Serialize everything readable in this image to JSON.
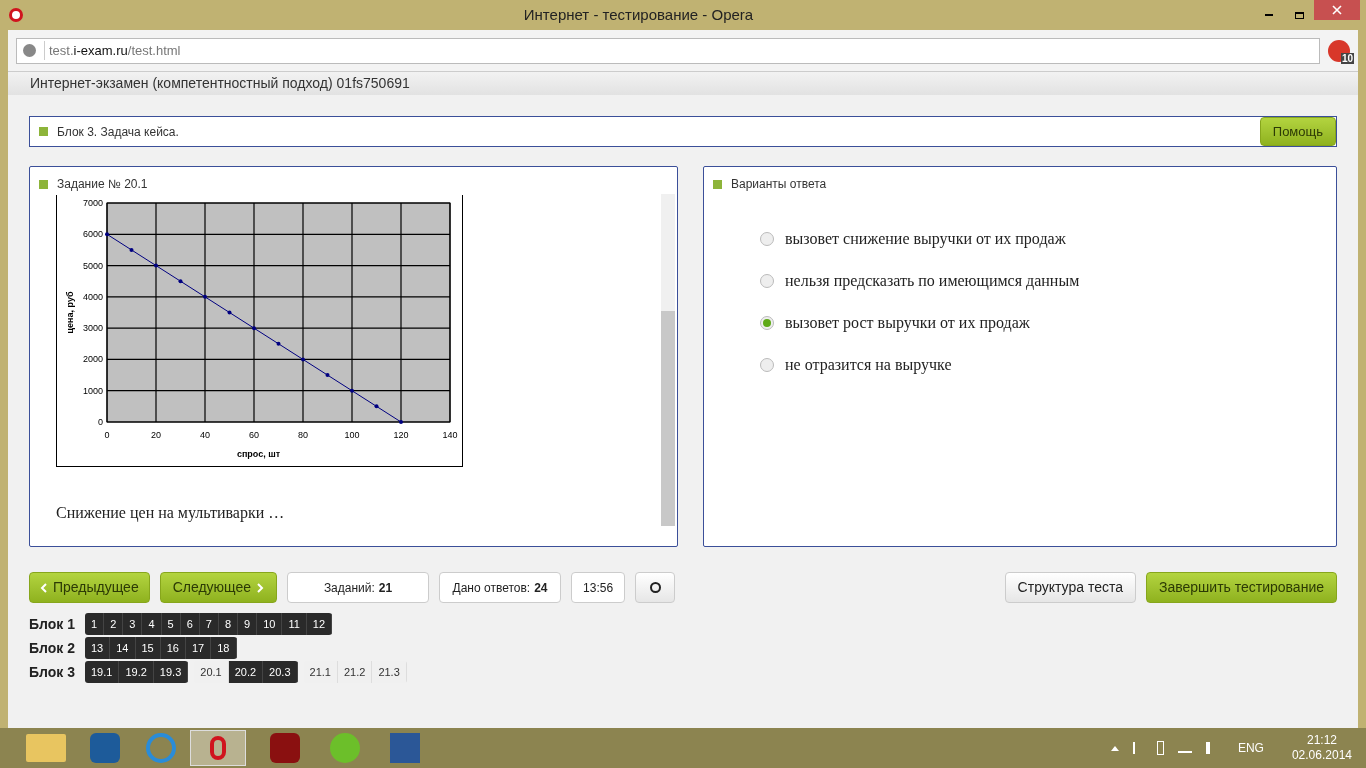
{
  "window": {
    "title": "Интернет - тестирование - Opera"
  },
  "address_bar": {
    "url_prefix": "test.",
    "url_domain": "i-exam.ru",
    "url_path": "/test.html",
    "badge": "10"
  },
  "page_header": "Интернет-экзамен (компетентностный подход) 01fs750691",
  "block_panel": {
    "title": "Блок 3. Задача кейса.",
    "help_button": "Помощь"
  },
  "task_panel": {
    "title": "Задание № 20.1",
    "question": "Снижение цен на мультиварки …",
    "chart_data": {
      "type": "line",
      "grid": true,
      "xlabel": "спрос, шт",
      "ylabel": "цена, руб",
      "xlim": [
        0,
        140
      ],
      "ylim": [
        0,
        7000
      ],
      "xticks": [
        0,
        20,
        40,
        60,
        80,
        100,
        120,
        140
      ],
      "yticks": [
        0,
        1000,
        2000,
        3000,
        4000,
        5000,
        6000,
        7000
      ],
      "series": [
        {
          "color": "#000080",
          "x": [
            0,
            10,
            20,
            30,
            40,
            50,
            60,
            70,
            80,
            90,
            100,
            110,
            120
          ],
          "values": [
            6000,
            5500,
            5000,
            4500,
            4000,
            3500,
            3000,
            2500,
            2000,
            1500,
            1000,
            500,
            0
          ]
        }
      ]
    }
  },
  "answers_panel": {
    "title": "Варианты ответа",
    "options": [
      {
        "label": "вызовет снижение выручки от их продаж",
        "selected": false
      },
      {
        "label": "нельзя предсказать по имеющимся данным",
        "selected": false
      },
      {
        "label": "вызовет рост выручки от их продаж",
        "selected": true
      },
      {
        "label": "не отразится на выручке",
        "selected": false
      }
    ]
  },
  "nav": {
    "prev": "Предыдущее",
    "next": "Следующее",
    "tasks_label": "Заданий:",
    "tasks_value": "21",
    "answered_label": "Дано ответов:",
    "answered_value": "24",
    "timer": "13:56",
    "structure": "Структура теста",
    "finish": "Завершить тестирование"
  },
  "blocks": [
    {
      "label": "Блок 1",
      "groups": [
        [
          {
            "n": "1",
            "answered": true
          },
          {
            "n": "2",
            "answered": true
          },
          {
            "n": "3",
            "answered": true
          },
          {
            "n": "4",
            "answered": true
          },
          {
            "n": "5",
            "answered": true
          },
          {
            "n": "6",
            "answered": true
          },
          {
            "n": "7",
            "answered": true
          },
          {
            "n": "8",
            "answered": true
          },
          {
            "n": "9",
            "answered": true
          },
          {
            "n": "10",
            "answered": true
          },
          {
            "n": "11",
            "answered": true
          },
          {
            "n": "12",
            "answered": true
          }
        ]
      ]
    },
    {
      "label": "Блок 2",
      "groups": [
        [
          {
            "n": "13",
            "answered": true
          },
          {
            "n": "14",
            "answered": true
          },
          {
            "n": "15",
            "answered": true
          },
          {
            "n": "16",
            "answered": true
          },
          {
            "n": "17",
            "answered": true
          },
          {
            "n": "18",
            "answered": true
          }
        ]
      ]
    },
    {
      "label": "Блок 3",
      "groups": [
        [
          {
            "n": "19.1",
            "answered": true
          },
          {
            "n": "19.2",
            "answered": true
          },
          {
            "n": "19.3",
            "answered": true
          }
        ],
        [
          {
            "n": "20.1",
            "answered": false
          },
          {
            "n": "20.2",
            "answered": true
          },
          {
            "n": "20.3",
            "answered": true
          }
        ],
        [
          {
            "n": "21.1",
            "answered": false
          },
          {
            "n": "21.2",
            "answered": false
          },
          {
            "n": "21.3",
            "answered": false
          }
        ]
      ]
    }
  ],
  "taskbar": {
    "language": "ENG",
    "time": "21:12",
    "date": "02.06.2014"
  }
}
